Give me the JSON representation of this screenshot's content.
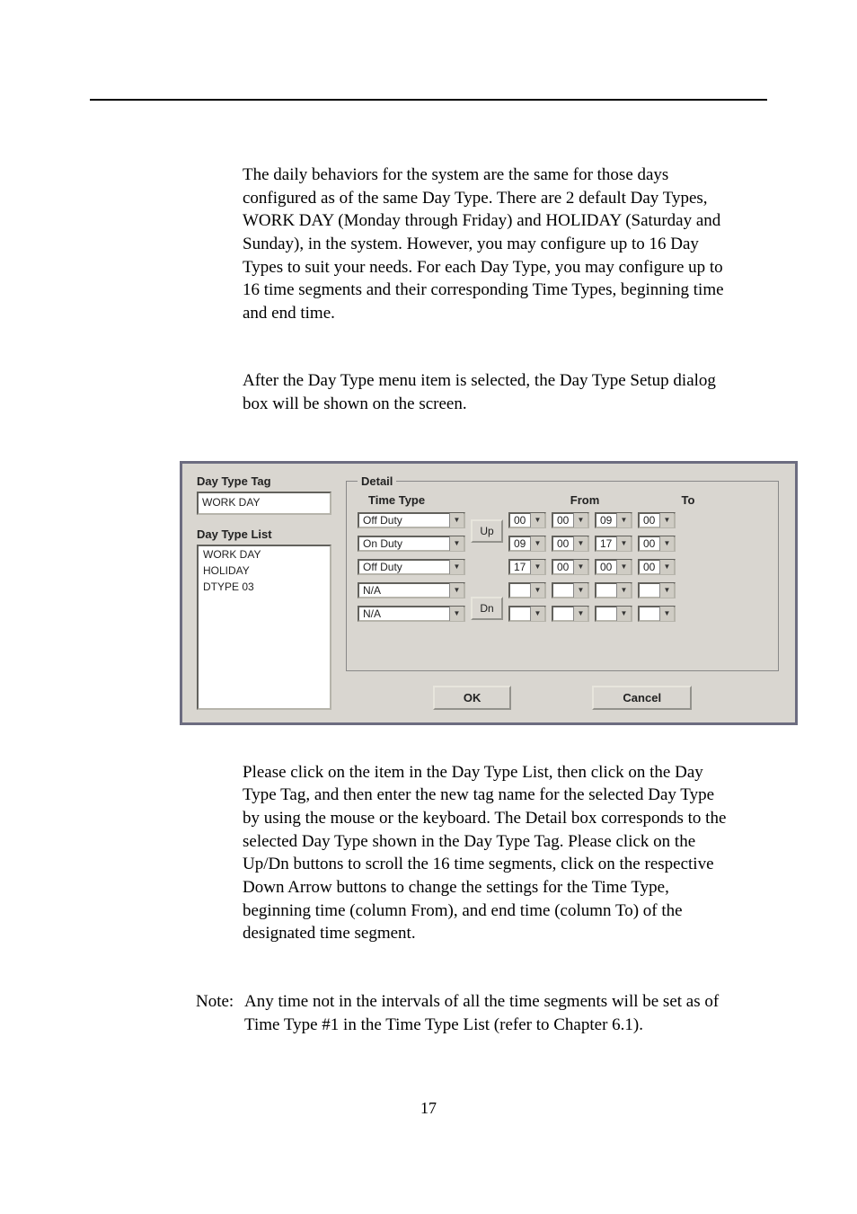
{
  "paragraphs": {
    "p1": "The daily behaviors for the system are the same for those days configured as of the same Day Type.    There are 2 default Day Types, WORK DAY (Monday through Friday) and HOLIDAY (Saturday and Sunday), in the system.    However, you may configure up to 16 Day Types to suit your needs. For each Day Type, you may configure up to 16 time segments and their corresponding Time Types, beginning time and end time.",
    "p2": "After the Day Type menu item is selected, the Day Type Setup dialog box will be shown on the screen.",
    "p3": "Please click on the item in the Day Type List, then click on the Day Type Tag, and then enter the new tag name for the selected Day Type by using the mouse or the keyboard.    The Detail box corresponds to the selected Day Type shown in the Day Type Tag.    Please click on the Up/Dn buttons to scroll the 16 time segments, click on the respective Down Arrow buttons to change the settings for the Time Type, beginning time (column From), and end time (column To) of the designated time segment.",
    "note_label": "Note:",
    "note_text": "Any time not in the intervals of all the time segments will be set as of Time Type #1 in the Time Type List (refer to Chapter 6.1)."
  },
  "dialog": {
    "tag_label": "Day Type Tag",
    "tag_value": "WORK DAY",
    "list_label": "Day Type List",
    "list_items": [
      "WORK DAY",
      "HOLIDAY",
      "DTYPE 03"
    ],
    "detail_legend": "Detail",
    "headers": {
      "time_type": "Time Type",
      "from": "From",
      "to": "To"
    },
    "rows": [
      {
        "tt": "Off Duty",
        "fh": "00",
        "fm": "00",
        "th": "09",
        "tm": "00"
      },
      {
        "tt": "On Duty",
        "fh": "09",
        "fm": "00",
        "th": "17",
        "tm": "00"
      },
      {
        "tt": "Off Duty",
        "fh": "17",
        "fm": "00",
        "th": "00",
        "tm": "00"
      },
      {
        "tt": "N/A",
        "fh": "",
        "fm": "",
        "th": "",
        "tm": ""
      },
      {
        "tt": "N/A",
        "fh": "",
        "fm": "",
        "th": "",
        "tm": ""
      }
    ],
    "up": "Up",
    "dn": "Dn",
    "ok": "OK",
    "cancel": "Cancel"
  },
  "page_number": "17"
}
